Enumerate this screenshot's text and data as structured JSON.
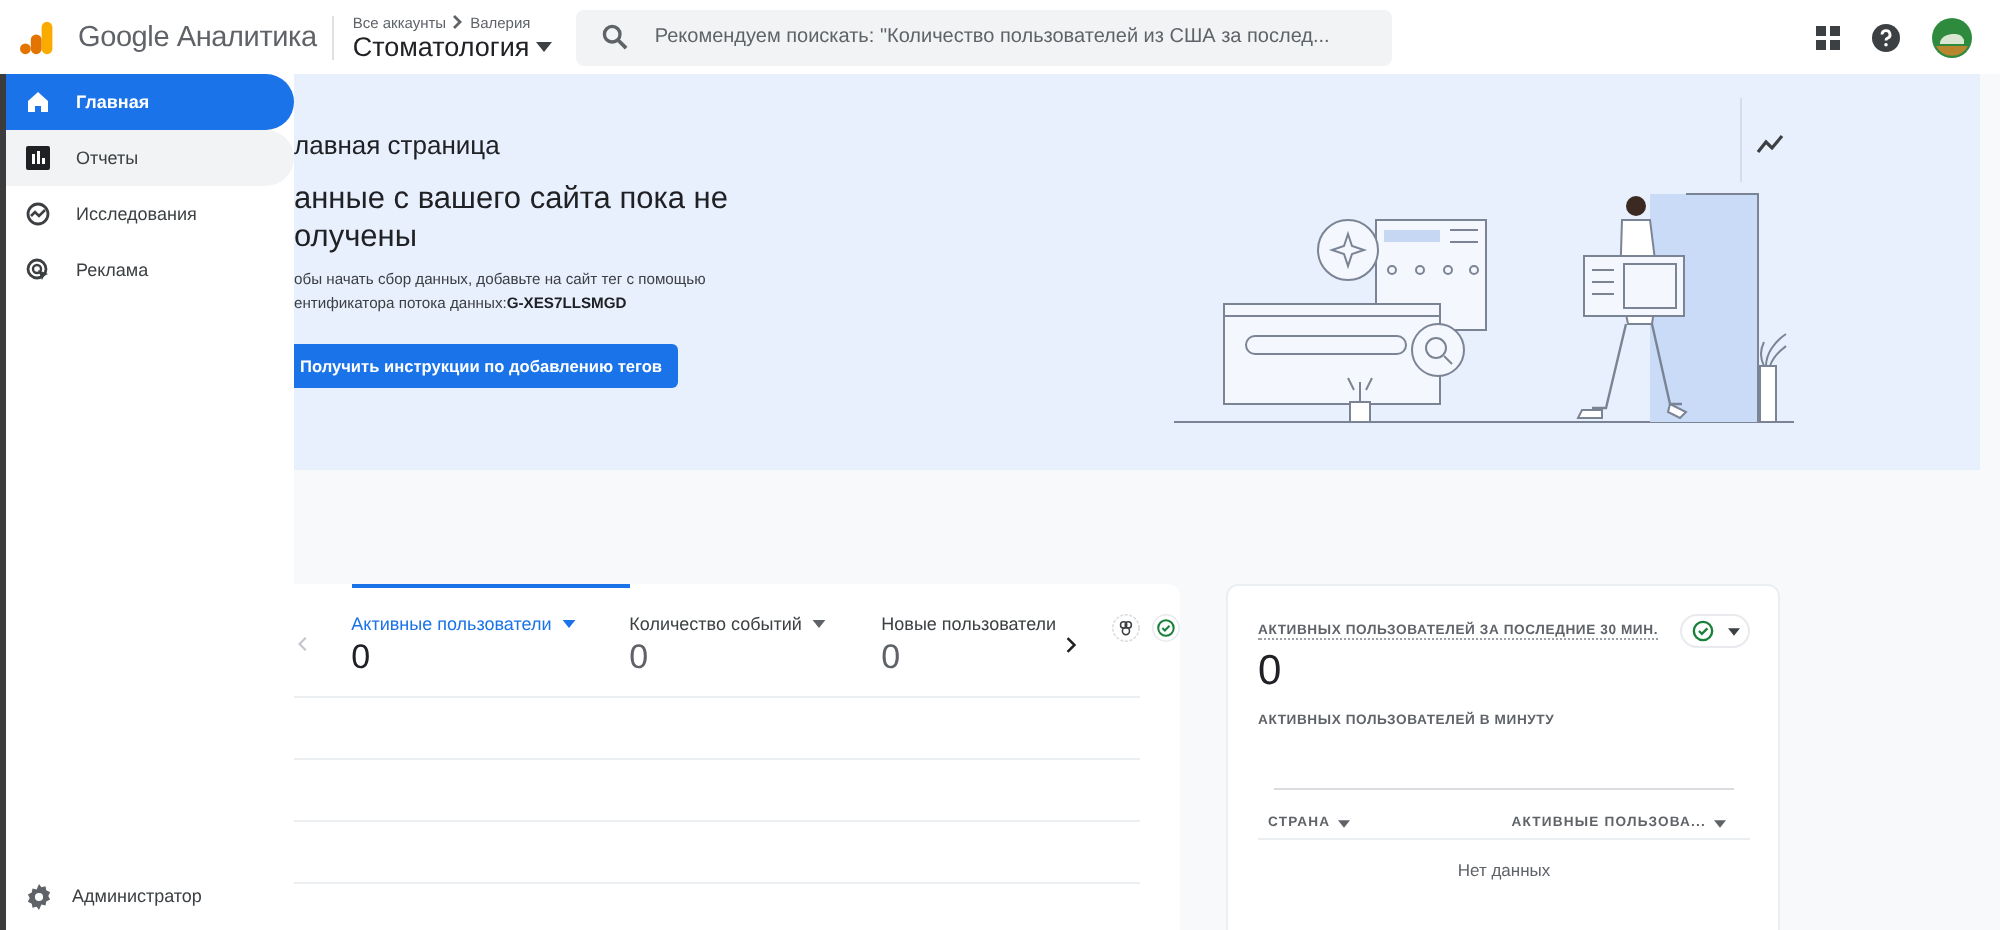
{
  "header": {
    "product": "Google Аналитика",
    "breadcrumb": [
      "Все аккаунты",
      "Валерия"
    ],
    "property": "Стоматология",
    "search": {
      "placeholder": "Рекомендуем поискать: \"Количество пользователей из США за послед..."
    }
  },
  "sidebar": {
    "items": [
      {
        "label": "Главная",
        "kind": "home",
        "selected": true,
        "hovered": false
      },
      {
        "label": "Отчеты",
        "kind": "reports",
        "selected": false,
        "hovered": true
      },
      {
        "label": "Исследования",
        "kind": "explore",
        "selected": false,
        "hovered": false
      },
      {
        "label": "Реклама",
        "kind": "ads",
        "selected": false,
        "hovered": false
      }
    ],
    "footer": {
      "label": "Администратор"
    }
  },
  "banner": {
    "title": "лавная страница",
    "heading": [
      "анные с вашего сайта пока не",
      "олучены"
    ],
    "text": [
      "обы начать сбор данных, добавьте на сайт тег с помощью",
      "ентификатора потока данных:"
    ],
    "stream_id": "G-XES7LLSMGD",
    "button": "Получить инструкции по добавлению тегов"
  },
  "metrics_card": {
    "metrics": [
      {
        "label": "Активные пользователи",
        "value": "0",
        "selected": true,
        "dropdown": true
      },
      {
        "label": "Количество событий",
        "value": "0",
        "selected": false,
        "dropdown": true
      },
      {
        "label": "Новые пользователи",
        "value": "0",
        "selected": false,
        "dropdown": false
      }
    ]
  },
  "realtime_card": {
    "title": "АКТИВНЫХ ПОЛЬЗОВАТЕЛЕЙ ЗА ПОСЛЕДНИЕ 30 МИН.",
    "value": "0",
    "subtitle": "АКТИВНЫХ ПОЛЬЗОВАТЕЛЕЙ В МИНУТУ",
    "columns": [
      "СТРАНА",
      "АКТИВНЫЕ ПОЛЬЗОВА..."
    ],
    "empty": "Нет данных"
  }
}
